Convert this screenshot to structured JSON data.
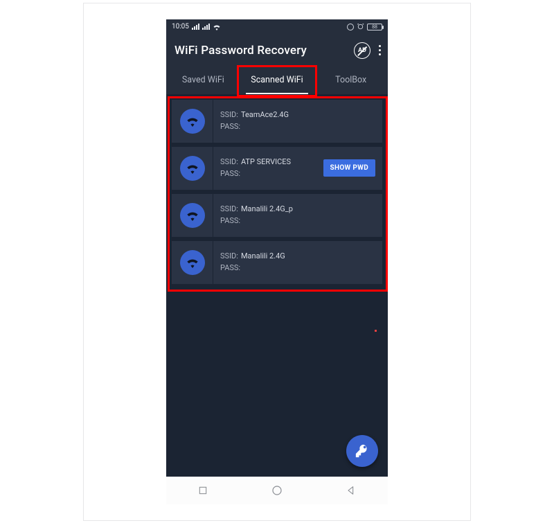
{
  "status": {
    "time": "10:05",
    "battery": "88"
  },
  "header": {
    "title": "WiFi Password Recovery",
    "ad_label": "AD"
  },
  "tabs": [
    {
      "label": "Saved WiFi",
      "active": false
    },
    {
      "label": "Scanned WiFi",
      "active": true
    },
    {
      "label": "ToolBox",
      "active": false
    }
  ],
  "labels": {
    "ssid": "SSID:",
    "pass": "PASS:",
    "show_pwd": "SHOW PWD"
  },
  "networks": [
    {
      "ssid": "TeamAce2.4G",
      "pass": "",
      "show_button": false
    },
    {
      "ssid": "ATP SERVICES",
      "pass": "",
      "show_button": true
    },
    {
      "ssid": "Manalili 2.4G_p",
      "pass": "",
      "show_button": false
    },
    {
      "ssid": "Manalili 2.4G",
      "pass": "",
      "show_button": false
    }
  ]
}
